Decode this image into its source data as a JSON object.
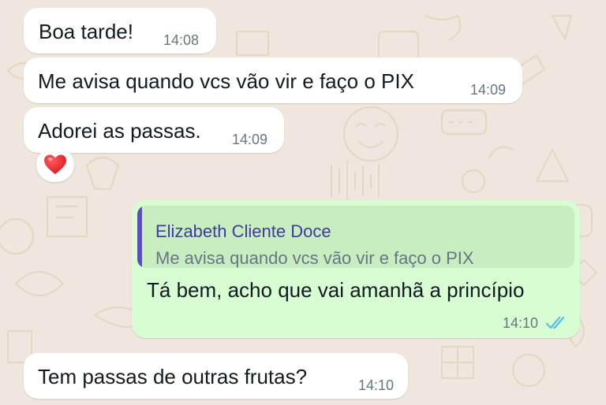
{
  "colors": {
    "chat_background": "#EFE7DD",
    "incoming_bubble": "#FFFFFF",
    "outgoing_bubble": "#D9FDD3",
    "quote_bar": "#5F4BC3",
    "read_ticks": "#53BDEB"
  },
  "messages": [
    {
      "direction": "incoming",
      "text": "Boa tarde!",
      "time": "14:08"
    },
    {
      "direction": "incoming",
      "text": "Me avisa quando vcs vão vir e faço o PIX",
      "time": "14:09"
    },
    {
      "direction": "incoming",
      "text": "Adorei as passas.",
      "time": "14:09",
      "reaction": "heart-icon"
    },
    {
      "direction": "outgoing",
      "quote": {
        "author": "Elizabeth Cliente Doce",
        "text": "Me avisa quando vcs vão vir e faço o PIX"
      },
      "text": "Tá bem, acho que vai amanhã a princípio",
      "time": "14:10",
      "status": "read-double-check-icon"
    },
    {
      "direction": "incoming",
      "text": "Tem passas de outras frutas?",
      "time": "14:10"
    }
  ]
}
